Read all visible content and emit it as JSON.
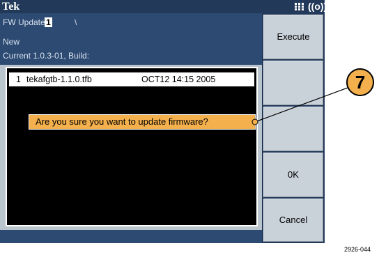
{
  "title_bar": {
    "brand": "Tek"
  },
  "info": {
    "fw_update_label": "FW Update",
    "fw_update_digit": "1",
    "fw_path": "\\",
    "new_label": "New",
    "current_label": "Current 1.0.3-01, Build:"
  },
  "file_list": [
    {
      "index": "1",
      "name": "tekafgtb-1.1.0.tfb",
      "date": "OCT12 14:15 2005"
    }
  ],
  "dialog": {
    "message": "Are you sure you want to update firmware?"
  },
  "softkeys": [
    {
      "label": "Execute"
    },
    {
      "label": ""
    },
    {
      "label": ""
    },
    {
      "label": "0K"
    },
    {
      "label": "Cancel"
    }
  ],
  "callout": {
    "number": "7"
  },
  "figure_id": "2926-044",
  "colors": {
    "title_bar": "#22395a",
    "info_area": "#2c4a72",
    "dialog": "#f4b04c",
    "softkey": "#c9d1d9"
  }
}
